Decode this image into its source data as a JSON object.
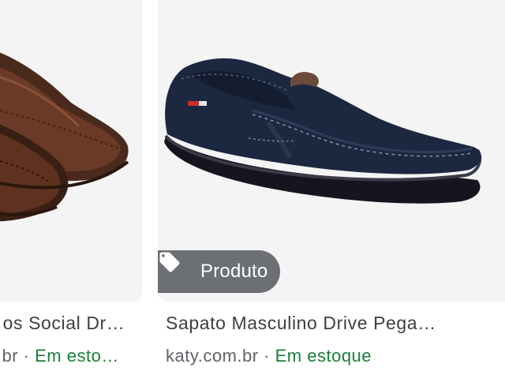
{
  "results": [
    {
      "title": "…os Social Dr…",
      "source": "…br",
      "separator": " · ",
      "availability": "Em esto…",
      "image_icon": "brown-loafer-shoes-image"
    },
    {
      "title": "Sapato Masculino Drive Pega…",
      "source": "katy.com.br",
      "separator": " · ",
      "availability": "Em estoque",
      "badge": {
        "icon": "tag-icon",
        "label": "Produto"
      },
      "image_icon": "navy-loafer-shoe-image"
    }
  ],
  "colors": {
    "availability": "#188038",
    "badge_bg": "#5f6368",
    "title": "#3c4043"
  }
}
